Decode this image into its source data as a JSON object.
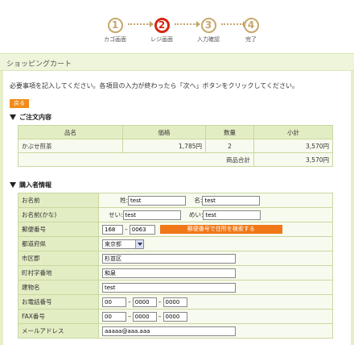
{
  "steps": [
    {
      "num": "1",
      "label": "カゴ画面"
    },
    {
      "num": "2",
      "label": "レジ画面"
    },
    {
      "num": "3",
      "label": "入力確認"
    },
    {
      "num": "4",
      "label": "完了"
    }
  ],
  "page_title": "ショッピングカート",
  "intro": "必要事項を記入してください。各項目の入力が終わったら「次へ」ボタンをクリックしてください。",
  "back_label": "戻る",
  "order": {
    "heading": "ご注文内容",
    "headers": [
      "品名",
      "価格",
      "数量",
      "小計"
    ],
    "row": {
      "name": "かぶせ煎茶",
      "price": "1,785円",
      "qty": "2",
      "subtotal": "3,570円"
    },
    "total_label": "商品合計",
    "total_value": "3,570円"
  },
  "buyer": {
    "heading": "購入者情報",
    "name_label": "お名前",
    "sei_label": "姓:",
    "sei_value": "test",
    "mei_label": "名:",
    "mei_value": "test",
    "kana_label": "お名前(かな)",
    "kana_sei_label": "せい:",
    "kana_sei_value": "test",
    "kana_mei_label": "めい:",
    "kana_mei_value": "test",
    "zip_label": "郵便番号",
    "zip1": "168",
    "zip2": "0063",
    "zip_search_label": "郵便番号で住所を検索する",
    "pref_label": "都道府県",
    "pref_value": "東京都",
    "city_label": "市区郡",
    "city_value": "杉並区",
    "town_label": "町村字番地",
    "town_value": "和泉",
    "building_label": "建物名",
    "building_value": "test",
    "tel_label": "お電話番号",
    "tel1": "00",
    "tel2": "0000",
    "tel3": "0000",
    "fax_label": "FAX番号",
    "fax1": "00",
    "fax2": "0000",
    "fax3": "0000",
    "email_label": "メールアドレス",
    "email_value": "aaaaa@aaa.aaa"
  },
  "colors": {
    "accent": "#d72610",
    "step": "#c6a86b",
    "button": "#f07818",
    "table_header": "#e3edc3"
  }
}
